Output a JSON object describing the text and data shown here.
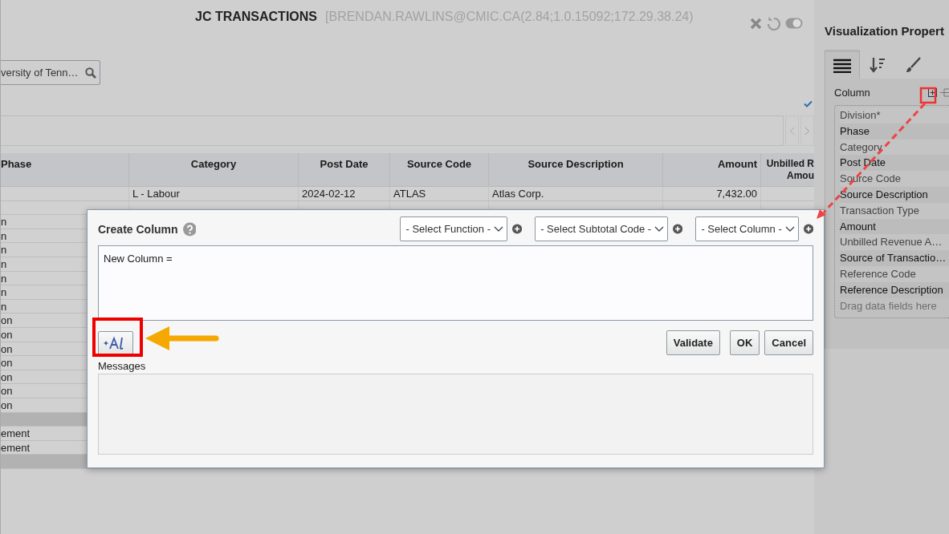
{
  "header": {
    "title": "JC TRANSACTIONS",
    "session_info": "[BRENDAN.RAWLINS@CMIC.CA(2.84;1.0.15092;172.29.38.24)"
  },
  "toggle": {
    "on": true
  },
  "search": {
    "value": "versity of Tenn…"
  },
  "table": {
    "columns": [
      {
        "label": "Phase",
        "numeric": false
      },
      {
        "label": "Category",
        "numeric": false
      },
      {
        "label": "Post Date",
        "numeric": false
      },
      {
        "label": "Source Code",
        "numeric": false
      },
      {
        "label": "Source Description",
        "numeric": false
      },
      {
        "label": "Amount",
        "numeric": true
      },
      {
        "label": "Unbilled R\nAmou",
        "numeric": true
      }
    ],
    "rows": [
      {
        "kind": "data",
        "cells": [
          null,
          "L - Labour",
          "2024-02-12",
          "ATLAS",
          "Atlas Corp.",
          "7,432.00",
          null
        ]
      },
      {
        "kind": "data",
        "cells": []
      },
      {
        "kind": "data",
        "cells": [
          "n"
        ]
      },
      {
        "kind": "data",
        "cells": [
          "n"
        ]
      },
      {
        "kind": "data",
        "cells": [
          "n"
        ]
      },
      {
        "kind": "data",
        "cells": [
          "n"
        ]
      },
      {
        "kind": "data",
        "cells": [
          "n"
        ]
      },
      {
        "kind": "data",
        "cells": [
          "n"
        ]
      },
      {
        "kind": "data",
        "cells": [
          "n"
        ]
      },
      {
        "kind": "data",
        "cells": [
          "on"
        ]
      },
      {
        "kind": "data",
        "cells": [
          "on"
        ]
      },
      {
        "kind": "data",
        "cells": [
          "on"
        ]
      },
      {
        "kind": "data",
        "cells": [
          "on"
        ]
      },
      {
        "kind": "data",
        "cells": [
          "on"
        ]
      },
      {
        "kind": "data",
        "cells": [
          "on"
        ]
      },
      {
        "kind": "data",
        "cells": [
          "on"
        ]
      },
      {
        "kind": "subtotal",
        "cells": []
      },
      {
        "kind": "data",
        "cells": [
          "ement"
        ]
      },
      {
        "kind": "data",
        "cells": [
          "ement"
        ]
      },
      {
        "kind": "subtotal",
        "cells": []
      }
    ]
  },
  "panel": {
    "title": "Visualization Propert",
    "tabs": [
      {
        "kind": "list",
        "selected": true
      },
      {
        "kind": "sort",
        "selected": false
      },
      {
        "kind": "style",
        "selected": false
      }
    ],
    "section_label": "Column",
    "fields": [
      "Division*",
      "Phase",
      "Category",
      "Post Date",
      "Source Code",
      "Source Description",
      "Transaction Type",
      "Amount",
      "Unbilled Revenue A…",
      "Source of Transactio…",
      "Reference Code",
      "Reference Description"
    ],
    "drop_hint": "Drag data fields here"
  },
  "dialog": {
    "title": "Create Column",
    "selects": [
      "- Select Function -",
      "- Select Subtotal Code -",
      "- Select Column -"
    ],
    "formula": "New Column =",
    "buttons": [
      "Validate",
      "OK",
      "Cancel"
    ],
    "messages_label": "Messages"
  }
}
